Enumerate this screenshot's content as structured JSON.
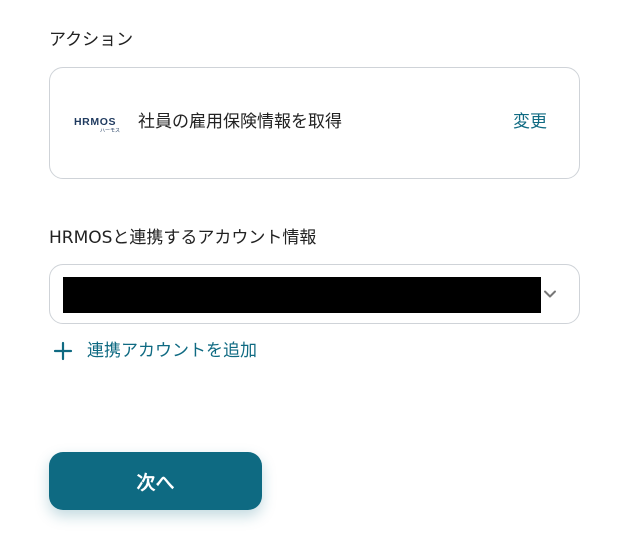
{
  "action_section": {
    "label": "アクション",
    "app": {
      "name": "HRMOS",
      "subtitle": "ハーモス"
    },
    "action_title": "社員の雇用保険情報を取得",
    "change_label": "変更"
  },
  "account_section": {
    "label": "HRMOSと連携するアカウント情報",
    "selected_value": "",
    "add_account_label": "連携アカウントを追加"
  },
  "next_button": {
    "label": "次へ"
  },
  "colors": {
    "accent": "#0e6a82",
    "link": "#0f6a82",
    "border": "#cfd3d8",
    "logo": "#1f3a5f"
  },
  "icons": {
    "select_indicator": "chevron-down-icon",
    "add": "plus-icon"
  }
}
